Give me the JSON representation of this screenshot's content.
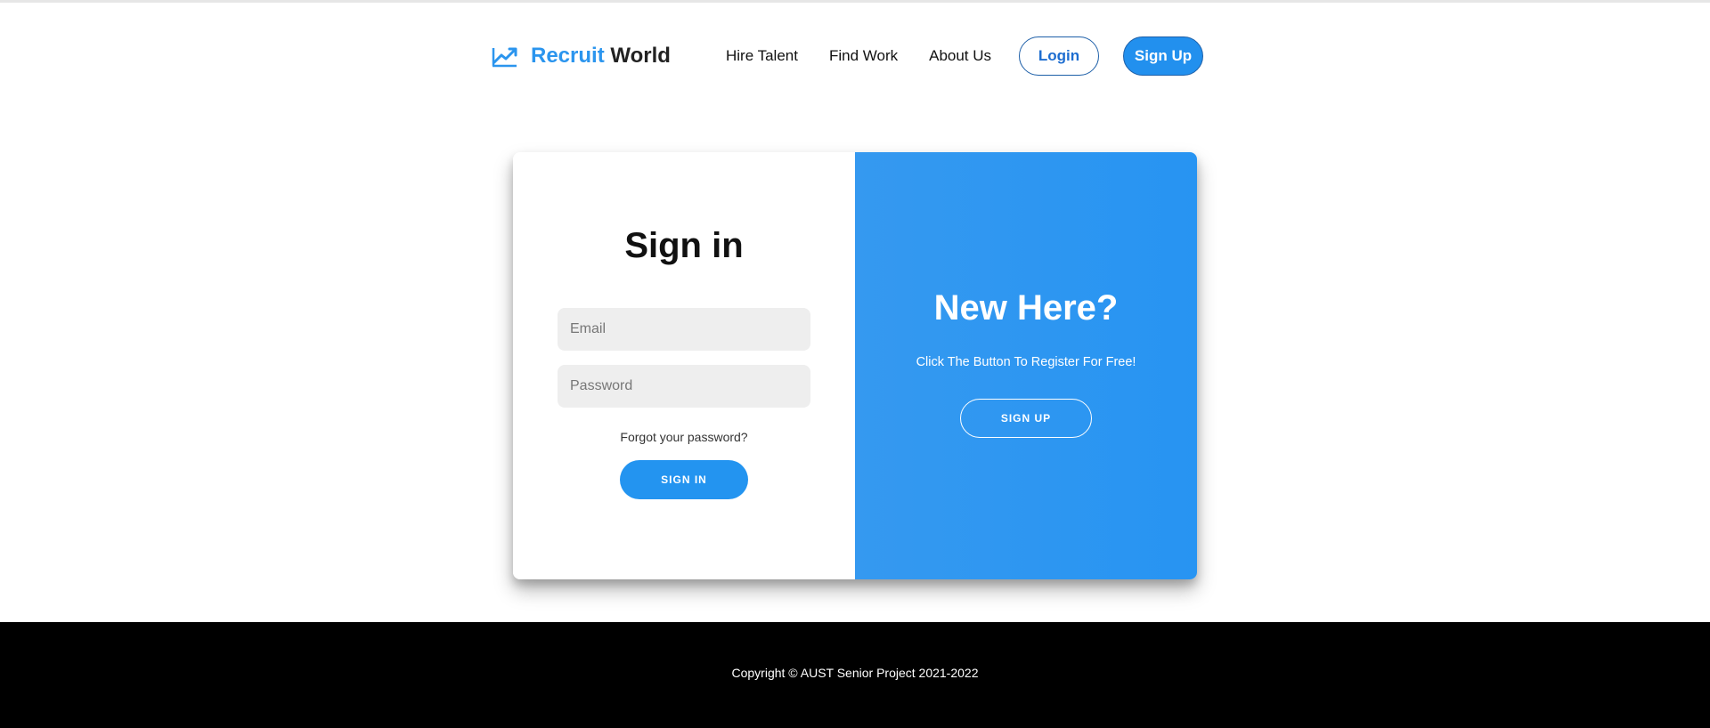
{
  "header": {
    "brand_accent": "Recruit",
    "brand_rest": "World",
    "brand_icon": "trending-up-icon",
    "nav": [
      {
        "label": "Hire Talent"
      },
      {
        "label": "Find Work"
      },
      {
        "label": "About Us"
      }
    ],
    "login_label": "Login",
    "signup_label": "Sign Up"
  },
  "signin": {
    "title": "Sign in",
    "email_placeholder": "Email",
    "password_placeholder": "Password",
    "forgot_label": "Forgot your password?",
    "button_label": "SIGN IN"
  },
  "panel": {
    "title": "New Here?",
    "subtitle": "Click The Button To Register For Free!",
    "button_label": "SIGN UP"
  },
  "footer": {
    "copyright": "Copyright © AUST Senior Project 2021-2022"
  },
  "colors": {
    "accent": "#2b95ee",
    "panel": "#2794f2",
    "footer": "#000000"
  }
}
